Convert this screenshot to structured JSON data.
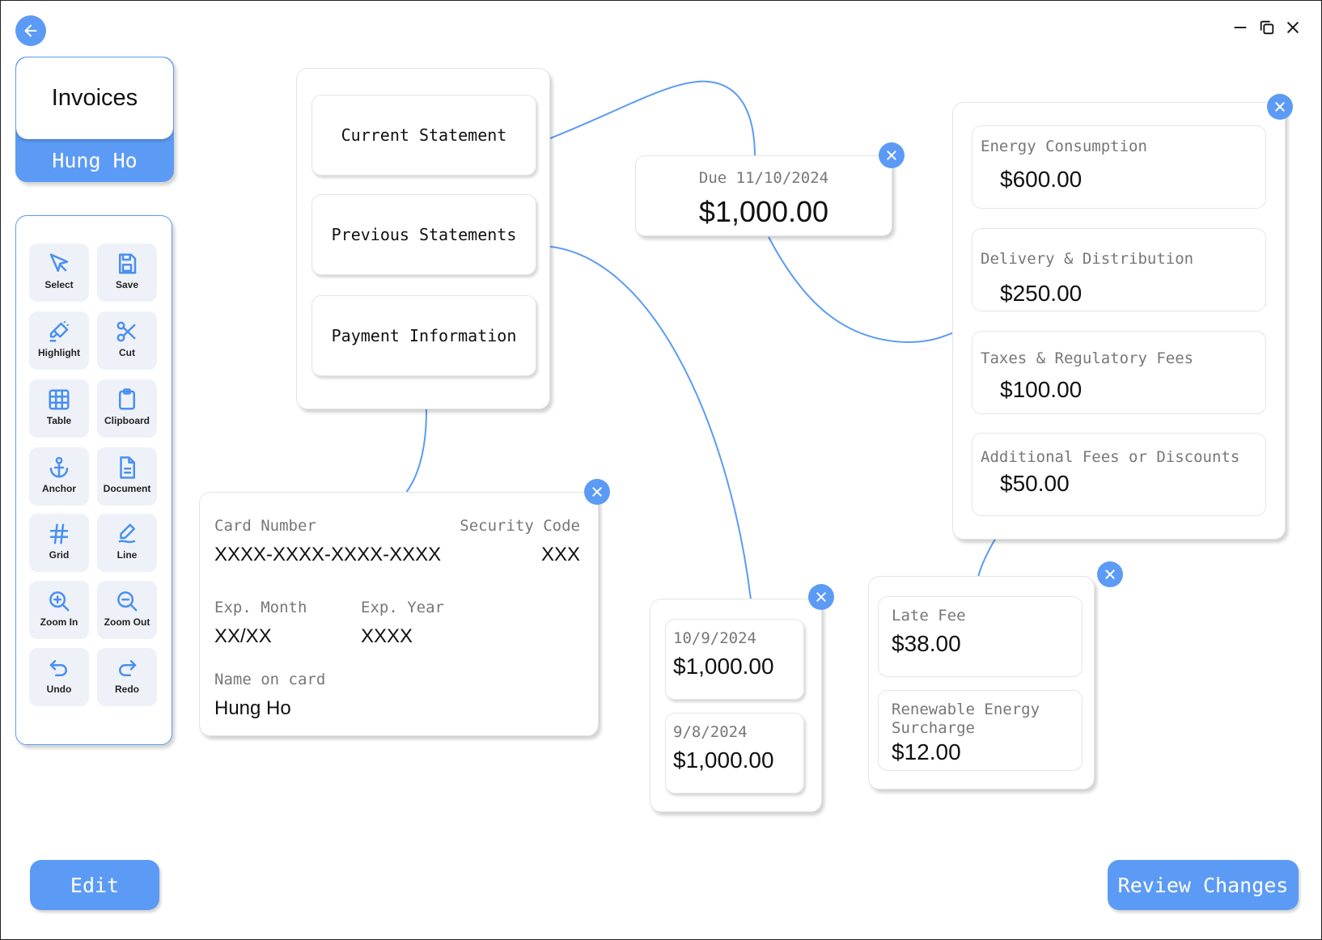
{
  "app": {
    "title": "Invoices",
    "user": "Hung Ho"
  },
  "tools": [
    {
      "label": "Select",
      "icon": "cursor-icon"
    },
    {
      "label": "Save",
      "icon": "save-icon"
    },
    {
      "label": "Highlight",
      "icon": "highlighter-icon"
    },
    {
      "label": "Cut",
      "icon": "scissors-icon"
    },
    {
      "label": "Table",
      "icon": "table-icon"
    },
    {
      "label": "Clipboard",
      "icon": "clipboard-icon"
    },
    {
      "label": "Anchor",
      "icon": "anchor-icon"
    },
    {
      "label": "Document",
      "icon": "document-icon"
    },
    {
      "label": "Grid",
      "icon": "hash-icon"
    },
    {
      "label": "Line",
      "icon": "pen-line-icon"
    },
    {
      "label": "Zoom In",
      "icon": "zoom-in-icon"
    },
    {
      "label": "Zoom Out",
      "icon": "zoom-out-icon"
    },
    {
      "label": "Undo",
      "icon": "undo-icon"
    },
    {
      "label": "Redo",
      "icon": "redo-icon"
    }
  ],
  "nav": {
    "current": "Current Statement",
    "previous": "Previous Statements",
    "payment": "Payment Information"
  },
  "due": {
    "label": "Due 11/10/2024",
    "amount": "$1,000.00"
  },
  "breakdown": [
    {
      "label": "Energy Consumption",
      "amount": "$600.00"
    },
    {
      "label": "Delivery & Distribution",
      "amount": "$250.00"
    },
    {
      "label": "Taxes & Regulatory Fees",
      "amount": "$100.00"
    },
    {
      "label": "Additional Fees or Discounts",
      "amount": "$50.00"
    }
  ],
  "additional_fees": [
    {
      "label": "Late Fee",
      "amount": "$38.00"
    },
    {
      "label": "Renewable Energy Surcharge",
      "amount": "$12.00"
    }
  ],
  "previous_statements": [
    {
      "date": "10/9/2024",
      "amount": "$1,000.00"
    },
    {
      "date": "9/8/2024",
      "amount": "$1,000.00"
    }
  ],
  "payment": {
    "card_number_label": "Card Number",
    "card_number": "XXXX-XXXX-XXXX-XXXX",
    "security_code_label": "Security Code",
    "security_code": "XXX",
    "exp_month_label": "Exp. Month",
    "exp_month": "XX/XX",
    "exp_year_label": "Exp. Year",
    "exp_year": "XXXX",
    "name_label": "Name on card",
    "name": "Hung Ho"
  },
  "actions": {
    "edit": "Edit",
    "review": "Review Changes"
  },
  "colors": {
    "accent": "#5c9bf5",
    "connector": "#5c9bf5",
    "tool_bg": "#eef2f8"
  }
}
